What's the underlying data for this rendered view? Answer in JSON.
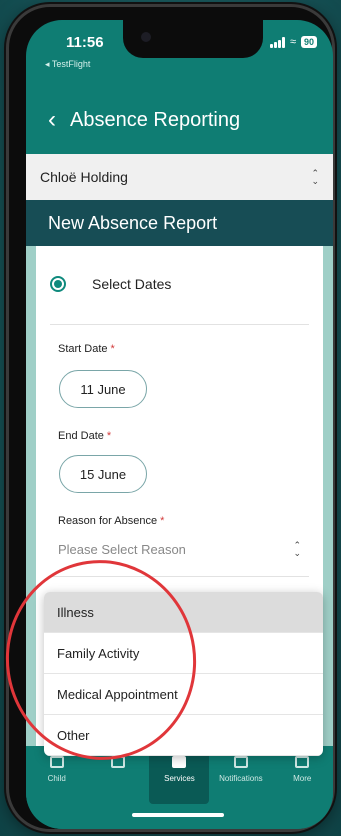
{
  "status": {
    "time": "11:56",
    "app_back": "◂ TestFlight",
    "battery": "90"
  },
  "nav": {
    "back_icon": "chevron-left-icon",
    "title": "Absence Reporting"
  },
  "user_selector": {
    "name": "Chloë Holding"
  },
  "section_header": "New Absence Report",
  "mode": {
    "label": "Select Dates",
    "selected": true
  },
  "start_date": {
    "label": "Start Date",
    "required": "*",
    "value": "11 June"
  },
  "end_date": {
    "label": "End Date",
    "required": "*",
    "value": "15 June"
  },
  "reason": {
    "label": "Reason for Absence",
    "required": "*",
    "placeholder": "Please Select Reason"
  },
  "dropdown_options": [
    "Illness",
    "Family Activity",
    "Medical Appointment",
    "Other"
  ],
  "tabs": [
    {
      "label": "Child",
      "icon": "child-icon"
    },
    {
      "label": "",
      "icon": "calendar-icon"
    },
    {
      "label": "Services",
      "icon": "services-icon",
      "active": true
    },
    {
      "label": "Notifications",
      "icon": "bell-icon"
    },
    {
      "label": "More",
      "icon": "more-icon"
    }
  ],
  "colors": {
    "accent": "#0f7d73",
    "header": "#174d55",
    "annotation": "#e0363a"
  }
}
